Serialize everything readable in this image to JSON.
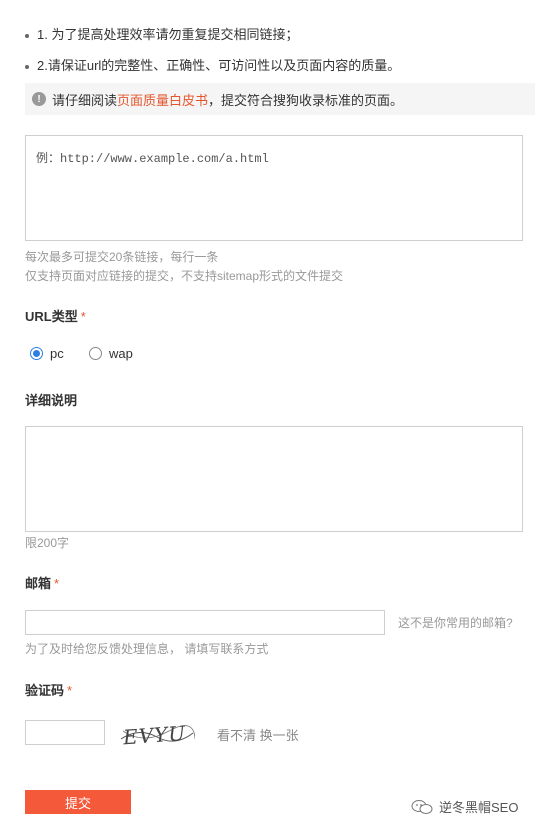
{
  "tips": [
    "1. 为了提高处理效率请勿重复提交相同链接；",
    "2.请保证url的完整性、正确性、可访问性以及页面内容的质量。"
  ],
  "notice": {
    "icon": "warning-icon",
    "before": "请仔细阅读",
    "link": "页面质量白皮书",
    "after": "，提交符合搜狗收录标准的页面。",
    "link_color": "#e4572e"
  },
  "url_field": {
    "placeholder": "例：http://www.example.com/a.html",
    "hint1": "每次最多可提交20条链接，每行一条",
    "hint2": "仅支持页面对应链接的提交，不支持sitemap形式的文件提交"
  },
  "url_type": {
    "label": "URL类型",
    "required_mark": "*",
    "options": [
      {
        "label": "pc",
        "checked": true
      },
      {
        "label": "wap",
        "checked": false
      }
    ]
  },
  "description": {
    "label": "详细说明",
    "hint": "限200字"
  },
  "email": {
    "label": "邮箱",
    "required_mark": "*",
    "value": "",
    "alt_link": "这不是你常用的邮箱?",
    "hint": "为了及时给您反馈处理信息， 请填写联系方式"
  },
  "captcha": {
    "label": "验证码",
    "required_mark": "*",
    "value": "",
    "image_text": "EVYU",
    "refresh_label": "看不清 换一张"
  },
  "submit_label": "提交",
  "watermark": "逆冬黑帽SEO",
  "colors": {
    "accent": "#f4593a",
    "radio": "#2d7fe0"
  }
}
